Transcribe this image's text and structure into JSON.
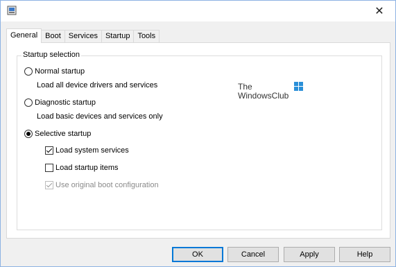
{
  "window": {
    "close_glyph": "✕"
  },
  "tabs": [
    {
      "label": "General"
    },
    {
      "label": "Boot"
    },
    {
      "label": "Services"
    },
    {
      "label": "Startup"
    },
    {
      "label": "Tools"
    }
  ],
  "active_tab": "General",
  "startup_selection": {
    "title": "Startup selection",
    "normal": {
      "label": "Normal startup",
      "description": "Load all device drivers and services",
      "selected": false
    },
    "diagnostic": {
      "label": "Diagnostic startup",
      "description": "Load basic devices and services only",
      "selected": false
    },
    "selective": {
      "label": "Selective startup",
      "selected": true
    },
    "options": {
      "system_services": {
        "label": "Load system services",
        "checked": true
      },
      "startup_items": {
        "label": "Load startup items",
        "checked": false
      },
      "boot_config": {
        "label": "Use original boot configuration",
        "checked": true,
        "disabled": true
      }
    }
  },
  "watermark": {
    "line1": "The",
    "line2": "WindowsClub"
  },
  "buttons": {
    "ok": "OK",
    "cancel": "Cancel",
    "apply": "Apply",
    "help": "Help"
  },
  "colors": {
    "accent": "#0078d7",
    "logo_blue": "#2a8fd8"
  },
  "icons": {
    "app": "msconfig-icon",
    "close": "close-icon",
    "logo": "windowsclub-logo-icon"
  }
}
